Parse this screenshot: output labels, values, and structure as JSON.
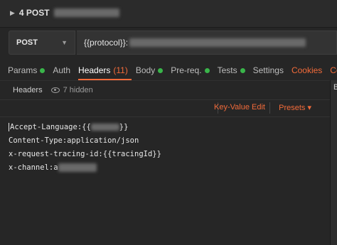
{
  "request": {
    "title": "4 POST"
  },
  "url_row": {
    "method": "POST",
    "url": "{{protocol}}:"
  },
  "tabs": [
    {
      "label": "Params",
      "dot": true
    },
    {
      "label": "Auth",
      "dot": false
    },
    {
      "label": "Headers",
      "count": "(11)",
      "active": true
    },
    {
      "label": "Body",
      "dot": true
    },
    {
      "label": "Pre-req.",
      "dot": true
    },
    {
      "label": "Tests",
      "dot": true
    },
    {
      "label": "Settings",
      "dot": false
    },
    {
      "label": "Cookies",
      "orange": true
    },
    {
      "label": "Code",
      "orange": true
    }
  ],
  "subbar": {
    "headers_label": "Headers",
    "hidden_label": "7 hidden"
  },
  "editorbar": {
    "kv_label": "Key-Value Edit",
    "presets_label": "Presets"
  },
  "editor": {
    "lines": [
      "Accept-Language:{{",
      "Content-Type:application/json",
      "x-request-tracing-id:{{tracingId}}",
      "x-channel:a"
    ],
    "line1_suffix": "}}"
  },
  "rightpane": {
    "label": "B"
  },
  "colors": {
    "accent": "#f26b3a",
    "status_dot": "#39b54a",
    "background": "#262626"
  }
}
